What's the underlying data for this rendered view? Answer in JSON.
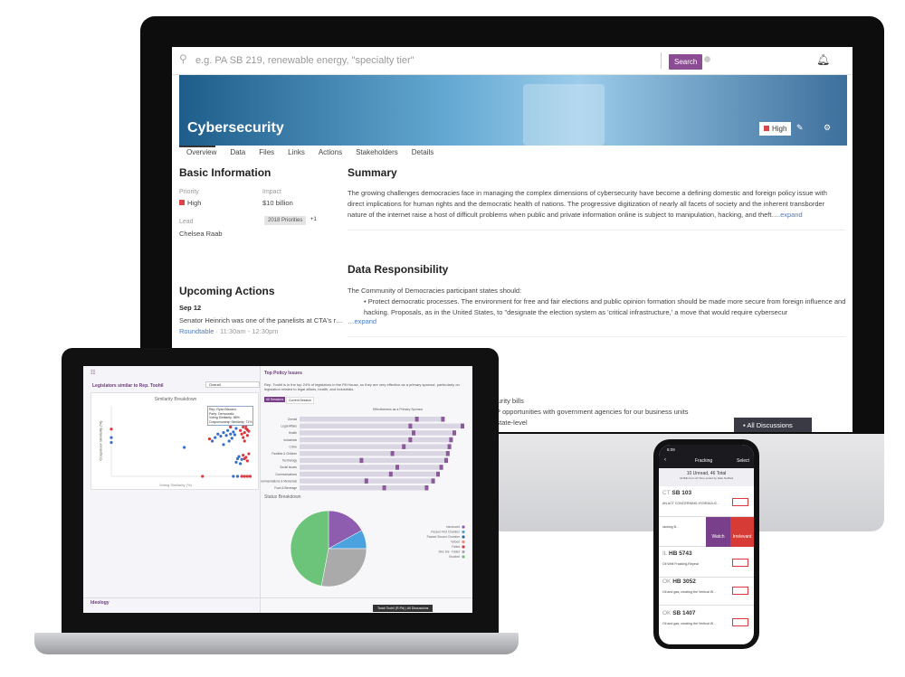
{
  "monitor": {
    "search": {
      "placeholder": "e.g. PA SB 219, renewable energy, \"specialty tier\"",
      "button": "Search"
    },
    "title": "Cybersecurity",
    "priority_badge": "High",
    "tabs": [
      "Overview",
      "Data",
      "Files",
      "Links",
      "Actions",
      "Stakeholders",
      "Details"
    ],
    "basic": {
      "heading": "Basic Information",
      "priority_label": "Priority",
      "priority": "High",
      "impact_label": "Impact",
      "impact": "$10 billion",
      "lead_label": "Lead",
      "lead": "Chelsea Raab",
      "tag": "2018 Priorities",
      "tag_more": "+1"
    },
    "summary": {
      "heading": "Summary",
      "text": "The growing challenges democracies face in managing the complex dimensions of cybersecurity have become a defining domestic and foreign policy issue with direct implications for human rights and the democratic health of nations. The progressive digitization of nearly all facets of society and the inherent transborder nature of the internet raise a host of difficult problems when public and private information online is subject to manipulation, hacking, and theft….",
      "expand": "expand"
    },
    "data_resp": {
      "heading": "Data Responsibility",
      "intro": "The Community of Democracies participant states should:",
      "bullet": "Protect democratic processes. The environment for free and fair elections and public opinion formation should be made more secure from foreign influence and hacking. Proposals, as in the United States, to \"designate the election system as 'critical infrastructure,' a move that would require cybersecur",
      "expand": "…expand"
    },
    "upcoming": {
      "heading": "Upcoming Actions",
      "date": "Sep 12",
      "text": "Senator Heinrich was one of the panelists at CTA's r…",
      "link": "Roundtable",
      "time": "· 11:30am - 12:30pm"
    },
    "partial_lines": [
      "security bills",
      "RFP opportunities with government agencies for our business units",
      "he state-level"
    ],
    "discussions": "All Discussions",
    "accent": "#8b4c93"
  },
  "laptop": {
    "similar_title": "Legislators similar to Rep. Toohil",
    "select": "Overall",
    "scatter_title": "Similarity Breakdown",
    "xlabel": "Voting Similarity (%)",
    "ylabel": "Cosponsor Similarity (%)",
    "tooltip": [
      "Rep. Ryan Bizzarro",
      "Party: Democratic",
      "Voting Similarity: 88%",
      "Cosponsorship Similarity: 71%"
    ],
    "policy_title": "Top Policy Issues",
    "policy_text": "Rep. Toohil is in the top 24% of legislators in the PA House, so they are very effective as a primary sponsor, particularly on legislation related to legal affairs, health, and industrials.",
    "session_tabs": [
      "All Sessions",
      "Current Session"
    ],
    "bar_axis_label": "Effectiveness as a Primary Sponsor",
    "status_title": "Status Breakdown",
    "ideology": "Ideology",
    "footer": [
      "Tarah Toohil (R-PA)",
      "All Discussions"
    ]
  },
  "chart_data": [
    {
      "type": "scatter",
      "title": "Similarity Breakdown",
      "xlabel": "Voting Similarity (%)",
      "ylabel": "Cosponsor Similarity (%)",
      "xlim": [
        0,
        100
      ],
      "ylim": [
        0,
        100
      ],
      "series": [
        {
          "color": "#3a6fc9",
          "points": [
            [
              0,
              55
            ],
            [
              0,
              48
            ],
            [
              52,
              41
            ],
            [
              72,
              50
            ],
            [
              74,
              55
            ],
            [
              76,
              60
            ],
            [
              78,
              57
            ],
            [
              80,
              62
            ],
            [
              82,
              58
            ],
            [
              83,
              65
            ],
            [
              85,
              60
            ],
            [
              86,
              54
            ],
            [
              87,
              63
            ],
            [
              88,
              59
            ],
            [
              84,
              50
            ],
            [
              80,
              45
            ],
            [
              89,
              68
            ],
            [
              85,
              70
            ],
            [
              90,
              25
            ],
            [
              89,
              20
            ],
            [
              91,
              28
            ],
            [
              92,
              18
            ],
            [
              93,
              24
            ],
            [
              87,
              0
            ],
            [
              90,
              0
            ]
          ]
        },
        {
          "color": "#d9383c",
          "points": [
            [
              0,
              67
            ],
            [
              70,
              53
            ],
            [
              85,
              70
            ],
            [
              92,
              65
            ],
            [
              94,
              70
            ],
            [
              95,
              62
            ],
            [
              96,
              68
            ],
            [
              97,
              58
            ],
            [
              94,
              55
            ],
            [
              98,
              64
            ],
            [
              95,
              50
            ],
            [
              96,
              72
            ],
            [
              97,
              66
            ],
            [
              93,
              60
            ],
            [
              94,
              30
            ],
            [
              96,
              27
            ],
            [
              98,
              32
            ],
            [
              95,
              25
            ],
            [
              97,
              22
            ],
            [
              65,
              0
            ],
            [
              93,
              0
            ],
            [
              95,
              0
            ],
            [
              97,
              0
            ],
            [
              99,
              0
            ]
          ]
        }
      ]
    },
    {
      "type": "bar",
      "title": "Effectiveness as a Primary Sponsor",
      "categories": [
        "Overall",
        "Legal Affairs",
        "Health",
        "Industrials",
        "Crime",
        "Families & Children",
        "Technology",
        "Social Issues",
        "Communications",
        "Commendations & Memorials",
        "Food & Beverage"
      ],
      "values": [
        88,
        100,
        95,
        93,
        92,
        91,
        90,
        87,
        85,
        82,
        78
      ],
      "markers": [
        [
          72,
          88
        ],
        [
          68,
          100
        ],
        [
          70,
          95
        ],
        [
          68,
          93
        ],
        [
          64,
          92
        ],
        [
          57,
          91
        ],
        [
          38,
          90
        ],
        [
          60,
          87
        ],
        [
          56,
          85
        ],
        [
          41,
          82
        ],
        [
          52,
          78
        ]
      ]
    },
    {
      "type": "pie",
      "title": "Status Breakdown",
      "labels": [
        "Introduced",
        "Passed First Chamber",
        "Passed Second Chamber",
        "Vetoed",
        "Failed",
        "Sine Die - Failed",
        "Enacted"
      ],
      "values": [
        17,
        8,
        0,
        0,
        0,
        28,
        47
      ],
      "colors": [
        "#8f5db0",
        "#4aa3df",
        "#2c6aa0",
        "#f08a7a",
        "#d9383c",
        "#aaaaaa",
        "#6cc47a"
      ]
    }
  ],
  "phone": {
    "time": "6:09",
    "title": "Fracking",
    "select": "Select",
    "summary": "10 Unread, 46 Total",
    "filter": "All Bills from All Time sorted by Date Notified",
    "bills": [
      {
        "state": "CT",
        "bill": "SB 103",
        "desc": "AN ACT CONCERNING HYDRAULIC…"
      },
      {
        "state": "",
        "bill": "",
        "desc": "racking B…"
      },
      {
        "state": "IL",
        "bill": "HB 5743",
        "desc": "Oil Well Fracking-Repeal"
      },
      {
        "state": "OK",
        "bill": "HB 3052",
        "desc": "Oil and gas; creating the Vertical W…"
      },
      {
        "state": "OK",
        "bill": "SB 1407",
        "desc": "Oil and gas; creating the Vertical W…"
      }
    ],
    "swipe": [
      "Watch",
      "Irrelevant"
    ]
  }
}
